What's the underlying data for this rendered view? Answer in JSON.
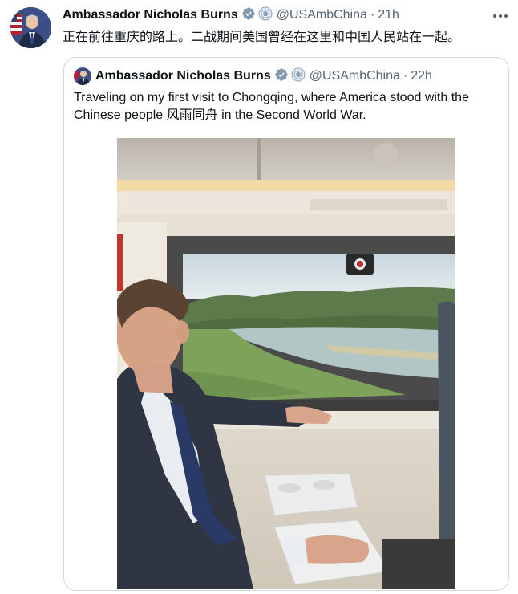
{
  "tweet": {
    "author_name": "Ambassador Nicholas Burns",
    "handle": "@USAmbChina",
    "separator": "·",
    "time": "21h",
    "text": "正在前往重庆的路上。二战期间美国曾经在这里和中国人民站在一起。",
    "more_icon": "more-icon"
  },
  "quoted": {
    "author_name": "Ambassador Nicholas Burns",
    "handle": "@USAmbChina",
    "separator": "·",
    "time": "22h",
    "text": "Traveling on my first visit to Chongqing, where America stood with the Chinese people 风雨同舟 in the Second World War."
  },
  "colors": {
    "verified": "#829aab",
    "muted": "#536471",
    "border": "#cfd9de"
  }
}
